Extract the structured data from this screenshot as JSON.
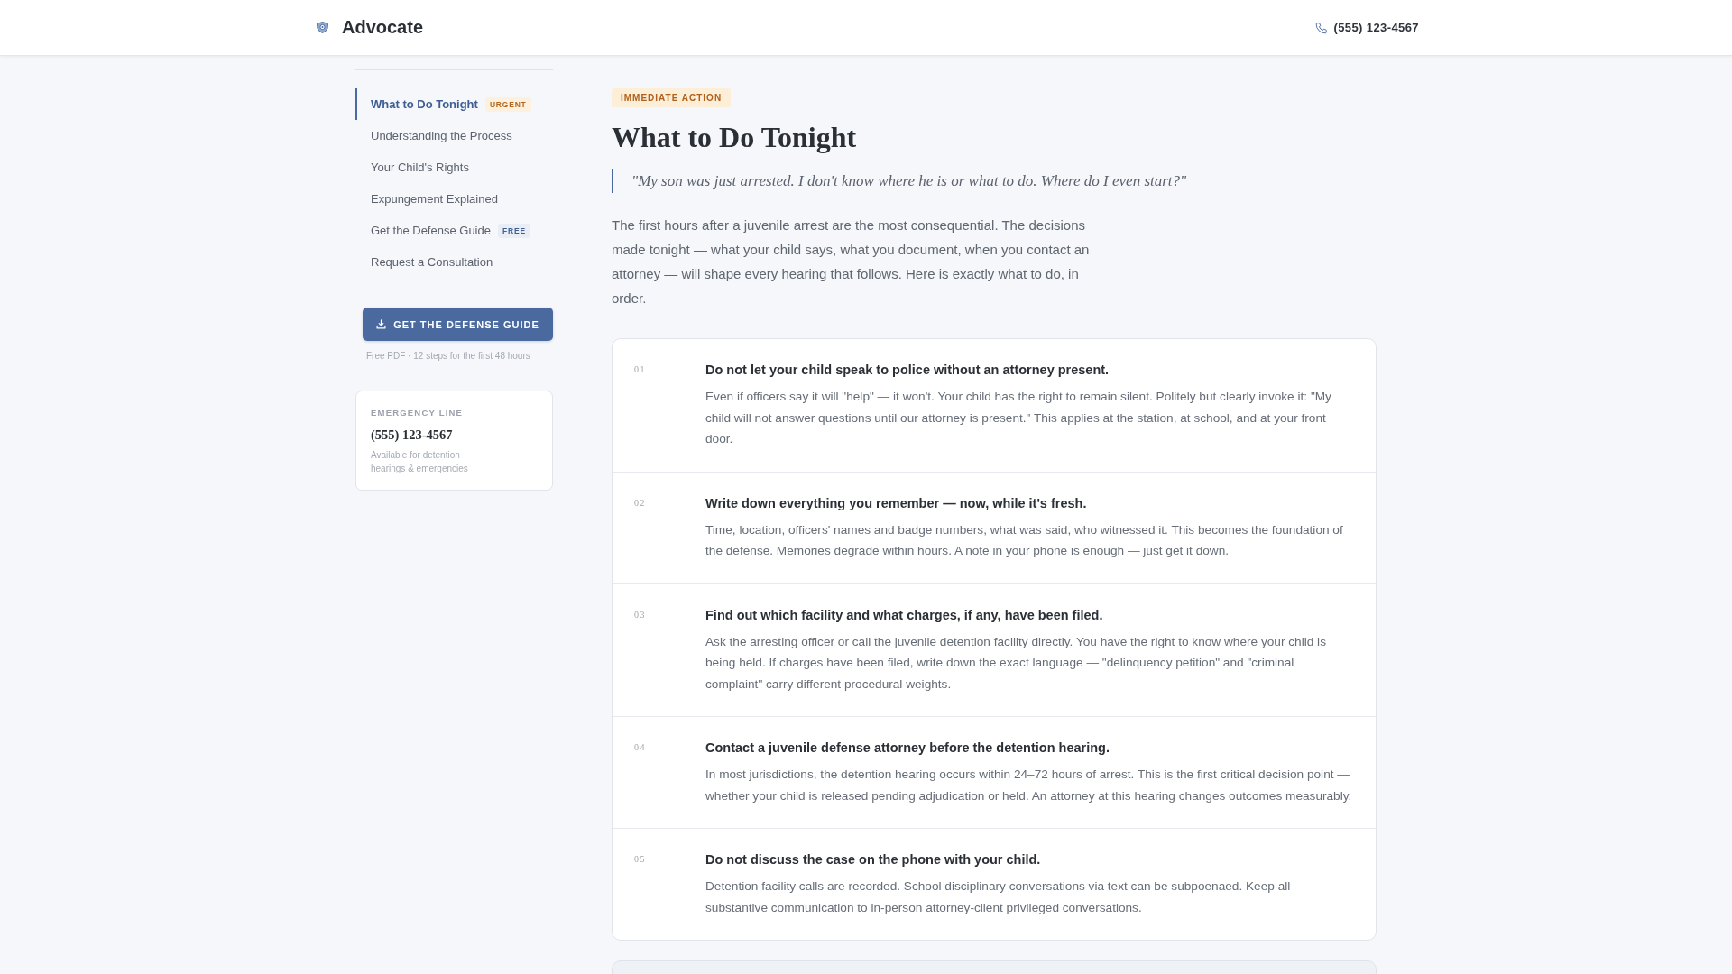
{
  "header": {
    "brand": "Advocate",
    "phone": "(555) 123-4567"
  },
  "sidebar": {
    "nav": [
      {
        "label": "What to Do Tonight",
        "selected": true,
        "badge": {
          "text": "URGENT",
          "kind": "urgent"
        }
      },
      {
        "label": "Understanding the Process",
        "selected": false
      },
      {
        "label": "Your Child's Rights",
        "selected": false
      },
      {
        "label": "Expungement Explained",
        "selected": false
      },
      {
        "label": "Get the Defense Guide",
        "selected": false,
        "badge": {
          "text": "FREE",
          "kind": "free"
        }
      },
      {
        "label": "Request a Consultation",
        "selected": false
      }
    ],
    "cta": {
      "label": "GET THE DEFENSE GUIDE",
      "caption": "Free PDF · 12 steps for the first 48 hours"
    },
    "emergency": {
      "label": "EMERGENCY LINE",
      "phone": "(555) 123-4567",
      "note": "Available for detention hearings & emergencies"
    }
  },
  "main": {
    "tag": "IMMEDIATE ACTION",
    "title": "What to Do Tonight",
    "quote": "\"My son was just arrested. I don't know where he is or what to do. Where do I even start?\"",
    "intro": "The first hours after a juvenile arrest are the most consequential. The decisions made tonight — what your child says, what you document, when you contact an attorney — will shape every hearing that follows. Here is exactly what to do, in order.",
    "steps": [
      {
        "number": "01",
        "title": "Do not let your child speak to police without an attorney present.",
        "body": "Even if officers say it will \"help\" — it won't. Your child has the right to remain silent. Politely but clearly invoke it: \"My child will not answer questions until our attorney is present.\" This applies at the station, at school, and at your front door."
      },
      {
        "number": "02",
        "title": "Write down everything you remember — now, while it's fresh.",
        "body": "Time, location, officers' names and badge numbers, what was said, who witnessed it. This becomes the foundation of the defense. Memories degrade within hours. A note in your phone is enough — just get it down."
      },
      {
        "number": "03",
        "title": "Find out which facility and what charges, if any, have been filed.",
        "body": "Ask the arresting officer or call the juvenile detention facility directly. You have the right to know where your child is being held. If charges have been filed, write down the exact language — \"delinquency petition\" and \"criminal complaint\" carry different procedural weights."
      },
      {
        "number": "04",
        "title": "Contact a juvenile defense attorney before the detention hearing.",
        "body": "In most jurisdictions, the detention hearing occurs within 24–72 hours of arrest. This is the first critical decision point — whether your child is released pending adjudication or held. An attorney at this hearing changes outcomes measurably."
      },
      {
        "number": "05",
        "title": "Do not discuss the case on the phone with your child.",
        "body": "Detention facility calls are recorded. School disciplinary conversations via text can be subpoenaed. Keep all substantive communication to in-person attorney-client privileged conversations."
      }
    ]
  }
}
